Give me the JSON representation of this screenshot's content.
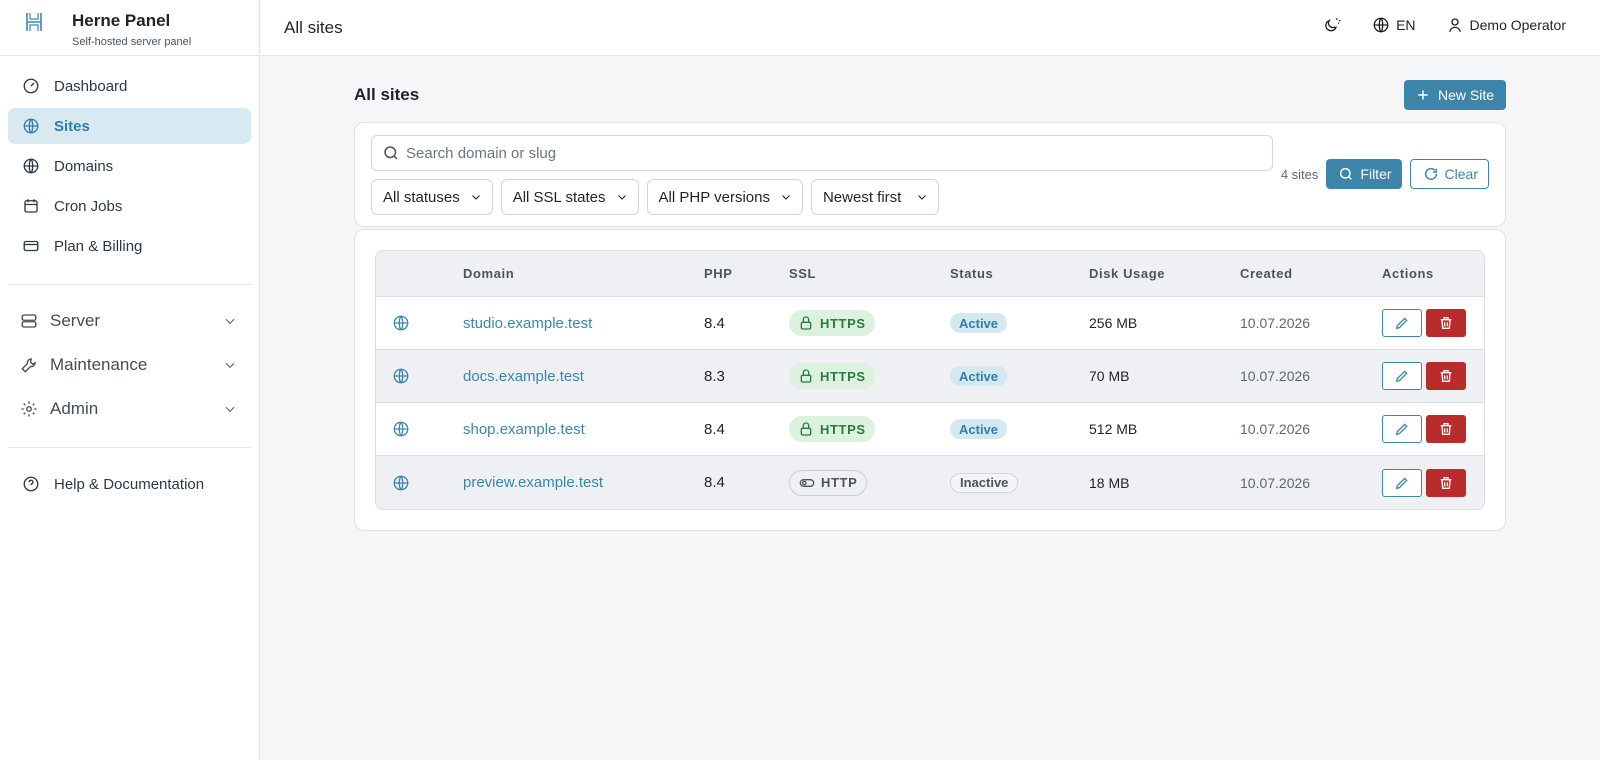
{
  "brand": {
    "title": "Herne Panel",
    "subtitle": "Self-hosted server panel",
    "logo_icon": "h-logo-icon"
  },
  "sidebar": {
    "items": [
      {
        "label": "Dashboard",
        "icon": "gauge-icon",
        "active": false
      },
      {
        "label": "Sites",
        "icon": "globe-icon",
        "active": true
      },
      {
        "label": "Domains",
        "icon": "globe-icon",
        "active": false
      },
      {
        "label": "Cron Jobs",
        "icon": "calendar-icon",
        "active": false
      },
      {
        "label": "Plan & Billing",
        "icon": "credit-card-icon",
        "active": false
      }
    ],
    "groups": [
      {
        "label": "Server",
        "icon": "server-icon"
      },
      {
        "label": "Maintenance",
        "icon": "wrench-icon"
      },
      {
        "label": "Admin",
        "icon": "gear-icon"
      }
    ],
    "help": {
      "label": "Help & Documentation",
      "icon": "help-circle-icon"
    }
  },
  "topbar": {
    "title": "All sites",
    "language": "EN",
    "user": "Demo Operator"
  },
  "main": {
    "title": "All sites",
    "new_site_label": "New Site"
  },
  "filters": {
    "search_placeholder": "Search domain or slug",
    "status": "All statuses",
    "ssl": "All SSL states",
    "php": "All PHP versions",
    "sort": "Newest first",
    "count": "4 sites",
    "filter_label": "Filter",
    "clear_label": "Clear"
  },
  "table": {
    "headers": {
      "domain": "Domain",
      "php": "PHP",
      "ssl": "SSL",
      "status": "Status",
      "disk": "Disk Usage",
      "created": "Created",
      "actions": "Actions"
    },
    "rows": [
      {
        "domain": "studio.example.test",
        "php": "8.4",
        "ssl": "HTTPS",
        "status": "Active",
        "disk": "256 MB",
        "created": "10.07.2026"
      },
      {
        "domain": "docs.example.test",
        "php": "8.3",
        "ssl": "HTTPS",
        "status": "Active",
        "disk": "70 MB",
        "created": "10.07.2026"
      },
      {
        "domain": "shop.example.test",
        "php": "8.4",
        "ssl": "HTTPS",
        "status": "Active",
        "disk": "512 MB",
        "created": "10.07.2026"
      },
      {
        "domain": "preview.example.test",
        "php": "8.4",
        "ssl": "HTTP",
        "status": "Inactive",
        "disk": "18 MB",
        "created": "10.07.2026"
      }
    ]
  },
  "colors": {
    "accent": "#3d86a9",
    "danger": "#b92c2c",
    "success_bg": "#dcf2df"
  }
}
